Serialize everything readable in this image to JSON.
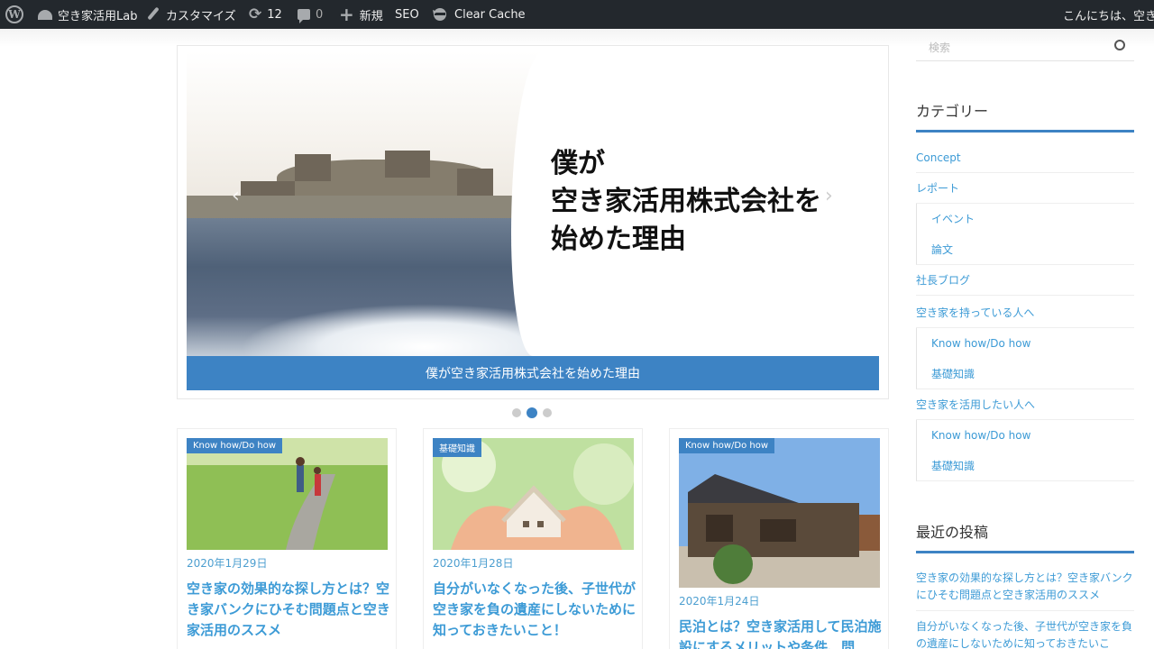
{
  "adminbar": {
    "site_name": "空き家活用Lab",
    "customize": "カスタマイズ",
    "updates_count": "12",
    "comments_count": "0",
    "new": "新規",
    "seo": "SEO",
    "clear_cache": "Clear Cache",
    "greeting": "こんにちは、空き"
  },
  "slider": {
    "title_lines": [
      "僕が",
      "空き家活用株式会社を",
      "始めた理由"
    ],
    "caption": "僕が空き家活用株式会社を始めた理由",
    "dots": 3,
    "active_dot": 2
  },
  "cards": [
    {
      "badge": "Know how/Do how",
      "date": "2020年1月29日",
      "title": "空き家の効果的な探し方とは？空き家バンクにひそむ問題点と空き家活用のススメ"
    },
    {
      "badge": "基礎知識",
      "date": "2020年1月28日",
      "title": "自分がいなくなった後、子世代が空き家を負の遺産にしないために知っておきたいこと！"
    },
    {
      "badge": "Know how/Do how",
      "date": "2020年1月24日",
      "title": "民泊とは？空き家活用して民泊施設にするメリットや条件、問"
    }
  ],
  "sidebar": {
    "search_placeholder": "検索",
    "categories_title": "カテゴリー",
    "categories": [
      {
        "label": "Concept",
        "child": false
      },
      {
        "label": "レポート",
        "child": false
      },
      {
        "label": "イベント",
        "child": true
      },
      {
        "label": "論文",
        "child": true
      },
      {
        "label": "社長ブログ",
        "child": false
      },
      {
        "label": "空き家を持っている人へ",
        "child": false
      },
      {
        "label": "Know how/Do how",
        "child": true
      },
      {
        "label": "基礎知識",
        "child": true
      },
      {
        "label": "空き家を活用したい人へ",
        "child": false
      },
      {
        "label": "Know how/Do how",
        "child": true
      },
      {
        "label": "基礎知識",
        "child": true
      }
    ],
    "recent_title": "最近の投稿",
    "recent_posts": [
      "空き家の効果的な探し方とは？空き家バンクにひそむ問題点と空き家活用のススメ",
      "自分がいなくなった後、子世代が空き家を負の遺産にしないために知っておきたいこ"
    ]
  },
  "colors": {
    "accent": "#3d83c4",
    "link": "#3d9bd6",
    "adminbar": "#23282d"
  }
}
